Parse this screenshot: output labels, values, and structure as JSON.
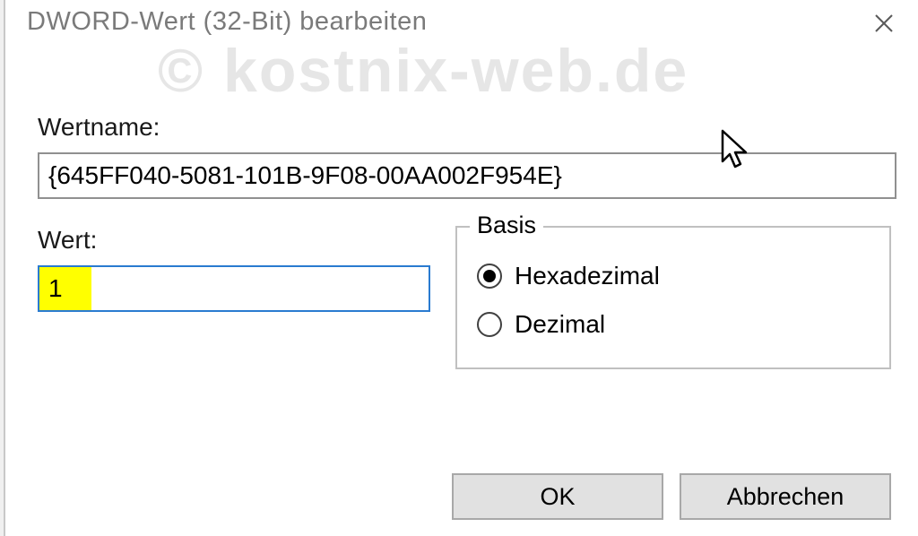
{
  "dialog": {
    "title": "DWORD-Wert (32-Bit) bearbeiten",
    "watermark": "© kostnix-web.de",
    "name_label": "Wertname:",
    "name_value": "{645FF040-5081-101B-9F08-00AA002F954E}",
    "value_label": "Wert:",
    "value_data": "1",
    "basis": {
      "legend": "Basis",
      "hex_label": "Hexadezimal",
      "dec_label": "Dezimal",
      "selected": "hex"
    },
    "buttons": {
      "ok": "OK",
      "cancel": "Abbrechen"
    }
  }
}
